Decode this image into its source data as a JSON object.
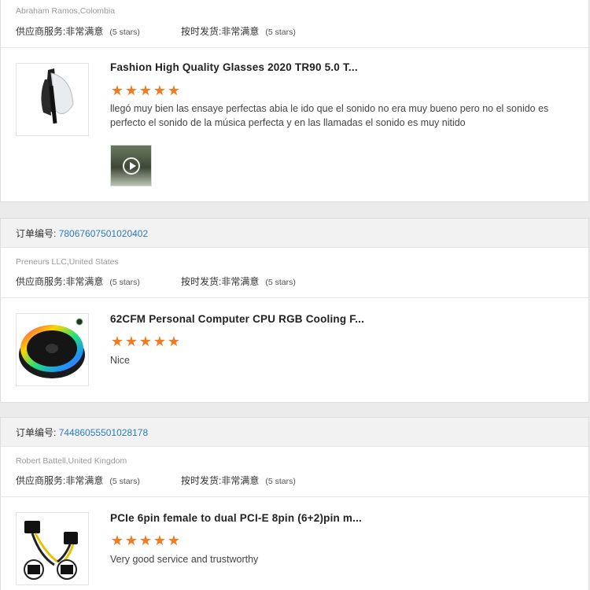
{
  "reviews": [
    {
      "order_label": "",
      "order_number": "",
      "buyer": "Abraham Ramos,Colombia",
      "supplier_service_label": "供应商服务:",
      "supplier_service_value": "非常满意",
      "supplier_service_stars": "(5 stars)",
      "shipping_label": "按时发货:",
      "shipping_value": "非常满意",
      "shipping_stars": "(5 stars)",
      "product_title": "Fashion High Quality Glasses 2020 TR90 5.0 T...",
      "rating": 5,
      "review_text": "llegó muy bien las ensaye perfectas abia le ido que el sonido no era muy bueno  pero no el sonido es perfecto el sonido de la música perfecta y en las llamadas el sonido es muy nitido",
      "product_icon": "glasses-product-image",
      "has_video": true
    },
    {
      "order_label": "订单编号:",
      "order_number": "78067607501020402",
      "buyer": "Preneurs LLC,United States",
      "supplier_service_label": "供应商服务:",
      "supplier_service_value": "非常满意",
      "supplier_service_stars": "(5 stars)",
      "shipping_label": "按时发货:",
      "shipping_value": "非常满意",
      "shipping_stars": "(5 stars)",
      "product_title": "62CFM Personal Computer CPU RGB Cooling F...",
      "rating": 5,
      "review_text": "Nice",
      "product_icon": "cpu-cooler-product-image",
      "has_video": false
    },
    {
      "order_label": "订单编号:",
      "order_number": "74486055501028178",
      "buyer": "Robert Battell,United Kingdom",
      "supplier_service_label": "供应商服务:",
      "supplier_service_value": "非常满意",
      "supplier_service_stars": "(5 stars)",
      "shipping_label": "按时发货:",
      "shipping_value": "非常满意",
      "shipping_stars": "(5 stars)",
      "product_title": "PCIe 6pin female to dual PCI-E 8pin (6+2)pin m...",
      "rating": 5,
      "review_text": "Very good service and trustworthy",
      "product_icon": "pcie-cable-product-image",
      "has_video": false
    }
  ],
  "star_glyph": "★",
  "colors": {
    "accent_star": "#f47a20",
    "order_link": "#2b7bbd"
  }
}
